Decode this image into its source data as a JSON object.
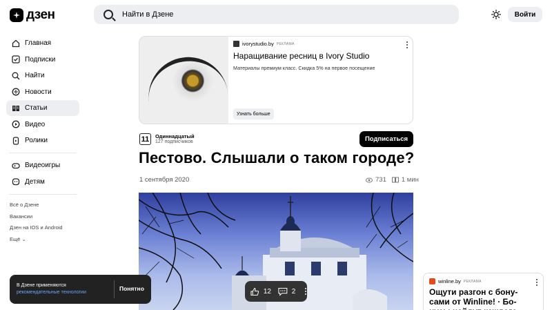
{
  "header": {
    "logo_text": "дзен",
    "search_placeholder": "Найти в Дзене",
    "login_label": "Войти"
  },
  "sidebar": {
    "items": [
      {
        "label": "Главная",
        "icon": "home-icon"
      },
      {
        "label": "Подписки",
        "icon": "subscriptions-icon"
      },
      {
        "label": "Найти",
        "icon": "search-icon"
      },
      {
        "label": "Новости",
        "icon": "news-icon"
      },
      {
        "label": "Статьи",
        "icon": "articles-icon",
        "active": true
      },
      {
        "label": "Видео",
        "icon": "video-icon"
      },
      {
        "label": "Ролики",
        "icon": "shorts-icon"
      }
    ],
    "items2": [
      {
        "label": "Видеоигры",
        "icon": "gamepad-icon"
      },
      {
        "label": "Детям",
        "icon": "kids-icon"
      }
    ],
    "links": [
      "Всё о Дзене",
      "Вакансии",
      "Дзен на IOS и Android",
      "Ещё"
    ]
  },
  "ad": {
    "domain": "ivorystudio.by",
    "tag": "РЕКЛАМА",
    "title": "Наращивание ресниц в Ivory Studio",
    "description": "Материалы премиум класс. Скидка 5% на первое посещение",
    "button": "Узнать больше"
  },
  "channel": {
    "avatar_text": "11",
    "name": "Одиннадцатый",
    "subscribers": "127 подписчиков",
    "subscribe_label": "Подписаться"
  },
  "article": {
    "title": "Пестово. Слышали о таком городе?",
    "date": "1 сентября 2020",
    "views": "731",
    "read_time": "1 мин"
  },
  "cookie": {
    "text_line1": "В Дзене применяются",
    "text_link": "рекомендательные технологии",
    "button": "Понятно"
  },
  "actions": {
    "likes": "12",
    "comments": "2"
  },
  "side_ad": {
    "domain": "winline.by",
    "tag": "РЕКЛАМА",
    "title": "Ощути разгон с бону- сами от Winline! · Бо- нусы найдут каждого"
  }
}
